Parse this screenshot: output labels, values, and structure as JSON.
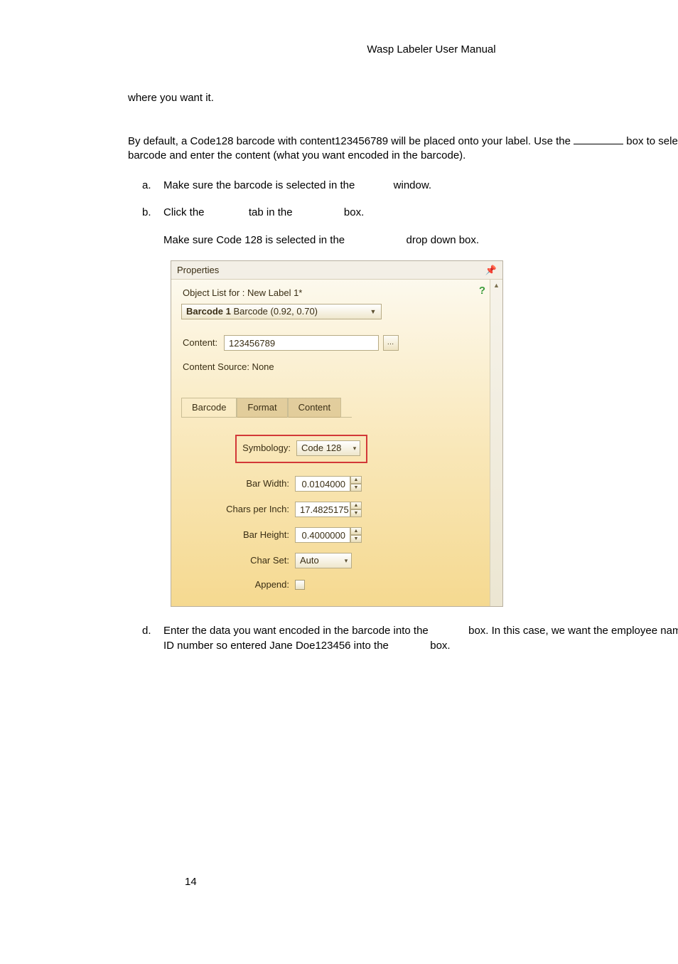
{
  "doc": {
    "header": "Wasp Labeler User Manual",
    "page_number": "14",
    "para1": "where you want it.",
    "para2_a": "By default, a Code128 barcode with content123456789 will be placed onto your label.  Use the ",
    "para2_b": " box to select the appropriate barcode and enter the content (what you want encoded in the barcode).",
    "items": {
      "a": {
        "marker": "a.",
        "text_a": "Make sure the barcode is selected in the ",
        "text_b": " window."
      },
      "b": {
        "marker": "b.",
        "line1_a": "Click the ",
        "line1_b": " tab in the ",
        "line1_c": " box.",
        "line2_a": "Make sure Code 128 is selected in the ",
        "line2_b": " drop down box."
      },
      "d": {
        "marker": "d.",
        "text_a": "Enter the data you want encoded in the barcode into the ",
        "text_b": " box.  In this case, we want the employee name and employee ID number so entered Jane Doe123456 into the ",
        "text_c": " box."
      }
    }
  },
  "panel": {
    "title": "Properties",
    "object_list_label": "Object List for :   New Label 1*",
    "selected_object_bold": "Barcode 1 ",
    "selected_object_rest": "Barcode (0.92, 0.70)",
    "content_label": "Content:",
    "content_value": "123456789",
    "content_source": "Content Source: None",
    "tabs": {
      "barcode": "Barcode",
      "format": "Format",
      "content": "Content"
    },
    "fields": {
      "symbology_label": "Symbology:",
      "symbology_value": "Code 128",
      "bar_width_label": "Bar Width:",
      "bar_width_value": "0.0104000",
      "cpi_label": "Chars per Inch:",
      "cpi_value": "17.4825175",
      "bar_height_label": "Bar Height:",
      "bar_height_value": "0.4000000",
      "charset_label": "Char Set:",
      "charset_value": "Auto",
      "append_label": "Append:"
    }
  }
}
